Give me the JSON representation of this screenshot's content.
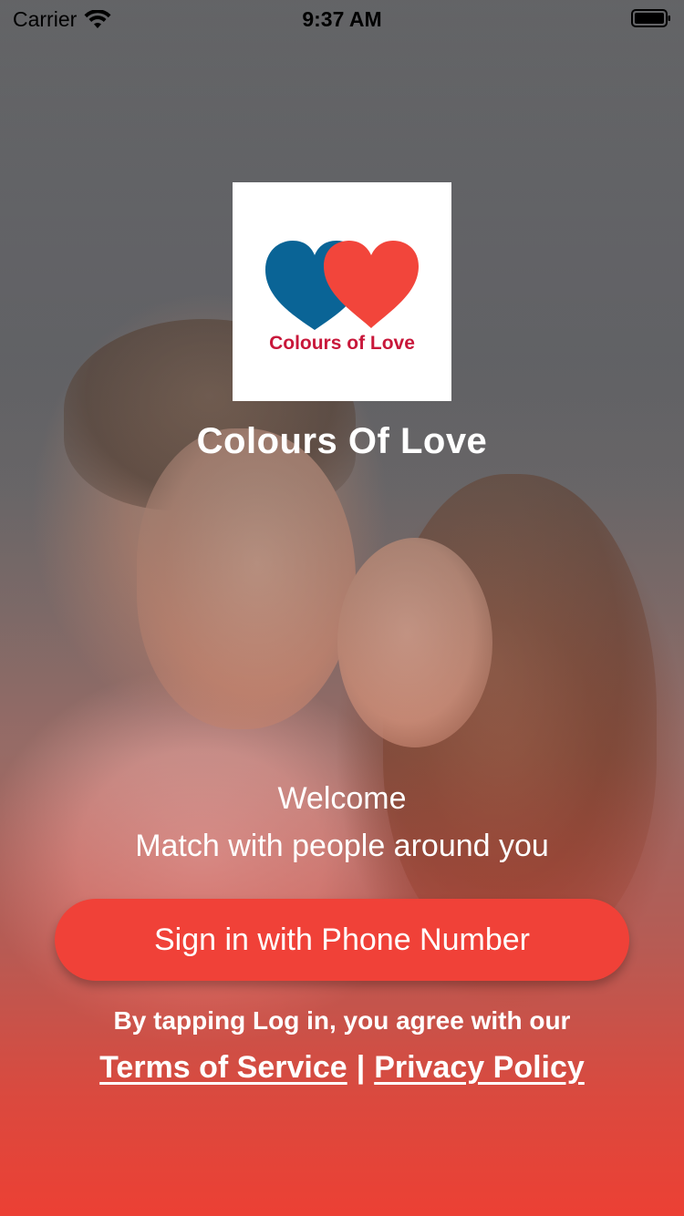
{
  "status_bar": {
    "carrier": "Carrier",
    "time": "9:37 AM",
    "wifi_icon": "wifi-icon",
    "battery_icon": "battery-icon"
  },
  "logo": {
    "icon": "two-hearts-icon",
    "text": "Colours of Love",
    "colors": {
      "blue_heart": "#0a6496",
      "red_heart": "#f2453b",
      "text": "#c8173a"
    }
  },
  "app_title": "Colours Of Love",
  "welcome": {
    "line1": "Welcome",
    "line2": "Match with people around you"
  },
  "signin_button": {
    "label": "Sign in with Phone Number",
    "color": "#f04138"
  },
  "legal": {
    "agree_text": "By tapping Log in, you agree with our",
    "terms_label": "Terms of Service",
    "separator": "|",
    "privacy_label": "Privacy Policy"
  },
  "colors": {
    "accent": "#f04138",
    "text_on_bg": "#ffffff"
  }
}
